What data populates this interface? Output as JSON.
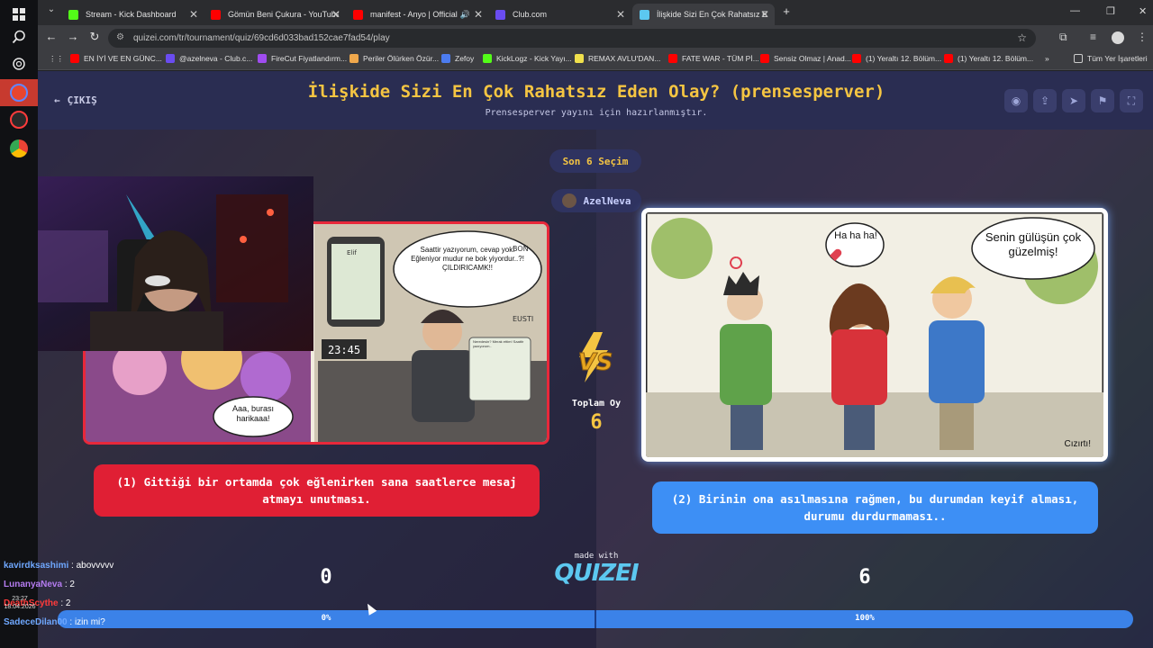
{
  "browser": {
    "tabs": [
      {
        "title": "Stream - Kick Dashboard",
        "color": "#53fc18",
        "active": false
      },
      {
        "title": "Gömün Beni Çukura - YouTube",
        "color": "#ff0000",
        "active": false
      },
      {
        "title": "manifest - Anyo | Official M",
        "color": "#ff0000",
        "active": false
      },
      {
        "title": "Club.com",
        "color": "#6a4cf0",
        "active": false
      },
      {
        "title": "İlişkide Sizi En Çok Rahatsız Ede",
        "color": "#5cc8f0",
        "active": true
      }
    ],
    "address": "quizei.com/tr/tournament/quiz/69cd6d033bad152cae7fad54/play",
    "bookmarks": [
      {
        "label": "EN İYİ VE EN GÜNC...",
        "color": "#ff0000"
      },
      {
        "label": "@azelneva - Club.c...",
        "color": "#6a4cf0"
      },
      {
        "label": "FireCut Fiyatlandırm...",
        "color": "#a04cf0"
      },
      {
        "label": "Periler Ölürken Özür...",
        "color": "#f0a84c"
      },
      {
        "label": "Zefoy",
        "color": "#4c7cf0"
      },
      {
        "label": "KickLogz - Kick Yayı...",
        "color": "#53fc18"
      },
      {
        "label": "REMAX AVLU'DAN...",
        "color": "#f0e04c"
      },
      {
        "label": "FATE WAR - TÜM Pİ...",
        "color": "#ff0000"
      },
      {
        "label": "Sensiz Olmaz | Anad...",
        "color": "#ff0000"
      },
      {
        "label": "(1) Yeraltı 12. Bölüm...",
        "color": "#ff0000"
      },
      {
        "label": "(1) Yeraltı 12. Bölüm...",
        "color": "#ff0000"
      }
    ],
    "all_bookmarks": "Tüm Yer İşaretleri"
  },
  "quiz": {
    "exit_label": "ÇIKIŞ",
    "title": "İlişkide Sizi En Çok Rahatsız Eden Olay? (prensesperver)",
    "subtitle": "Prensesperver yayını için hazırlanmıştır.",
    "round_label": "Son 6 Seçim",
    "user": "AzelNeva",
    "total_votes_label": "Toplam Oy",
    "total_votes": "6",
    "option_left": "(1) Gittiği bir ortamda çok eğlenirken sana saatlerce mesaj atmayı unutması.",
    "option_right": "(2) Birinin ona asılmasına rağmen, bu durumdan keyif alması, durumu durdurmaması..",
    "left_count": "0",
    "right_count": "6",
    "left_pct_label": "0%",
    "right_pct_label": "100%",
    "left_share": 0,
    "made_with": "made with",
    "brand": "QUIZEI"
  },
  "comic_left": {
    "bubble_1": "Saattir yazıyorum, cevap yok! Eğleniyor mudur ne bok yiyordur..?! ÇILDIRICAMK!!",
    "bubble_2": "Aaa, burası harikaaa!",
    "clock": "23:45",
    "phone_name": "Elif",
    "sign_1": "BON",
    "sign_2": "EUSTI",
    "note": "Neredesin? Merak ettim! Saattir yazıyorum.."
  },
  "comic_right": {
    "bubble_1": "Ha ha ha!",
    "bubble_2": "Senin gülüşün çok güzelmiş!",
    "caption": "Cızırtı!"
  },
  "chat": [
    {
      "user": "kavirdksashimi",
      "text": ": abovvvvv",
      "color": "#6fa8ff"
    },
    {
      "user": "LunanyaNeva",
      "text": ": 2",
      "color": "#b57cf0"
    },
    {
      "user": "DeathScythe",
      "text": ": 2",
      "color": "#ff3b3b"
    },
    {
      "user": "SadeceDilan00",
      "text": ": izin mi?",
      "color": "#6fa8ff"
    }
  ],
  "system": {
    "time": "23:27",
    "date": "18.04.2026"
  }
}
